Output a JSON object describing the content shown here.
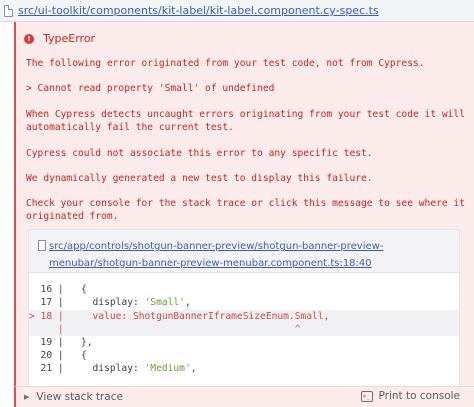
{
  "file_header": {
    "path": "src/ui-toolkit/components/kit-label/kit-label.component.cy-spec.ts",
    "icon": "file-icon"
  },
  "error": {
    "icon": "error-circle-icon",
    "title": "TypeError",
    "accent_color": "#c42525",
    "panel_color": "#fbeceb",
    "message_lines": [
      "The following error originated from your test code, not from Cypress.",
      "  > Cannot read property 'Small' of undefined",
      "When Cypress detects uncaught errors originating from your test code it will",
      "automatically fail the current test.",
      "Cypress could not associate this error to any specific test.",
      "We dynamically generated a new test to display this failure.",
      "Check your console for the stack trace or click this message to see where it",
      "originated from."
    ]
  },
  "code_frame": {
    "icon": "file-icon",
    "path": "src/app/controls/shotgun-banner-preview/shotgun-banner-preview-menubar/shotgun-banner-preview-menubar.component.ts:18:40",
    "lines": [
      {
        "text": "  16 |   {"
      },
      {
        "text": "  17 |     display: ",
        "str": "'Small'",
        "rest": ","
      },
      {
        "text": "> 18 |     value: ShotgunBannerIframeSizeEnum.Small,"
      },
      {
        "text": "     |                                        ^"
      },
      {
        "text": "  19 |   },"
      },
      {
        "text": "  20 |   {"
      },
      {
        "text": "  21 |     display: ",
        "str": "'Medium'",
        "rest": ","
      }
    ]
  },
  "footer": {
    "stack_trace_label": "View stack trace",
    "stack_trace_icon": "caret-right-icon",
    "print_label": "Print to console",
    "print_icon": "terminal-icon"
  }
}
